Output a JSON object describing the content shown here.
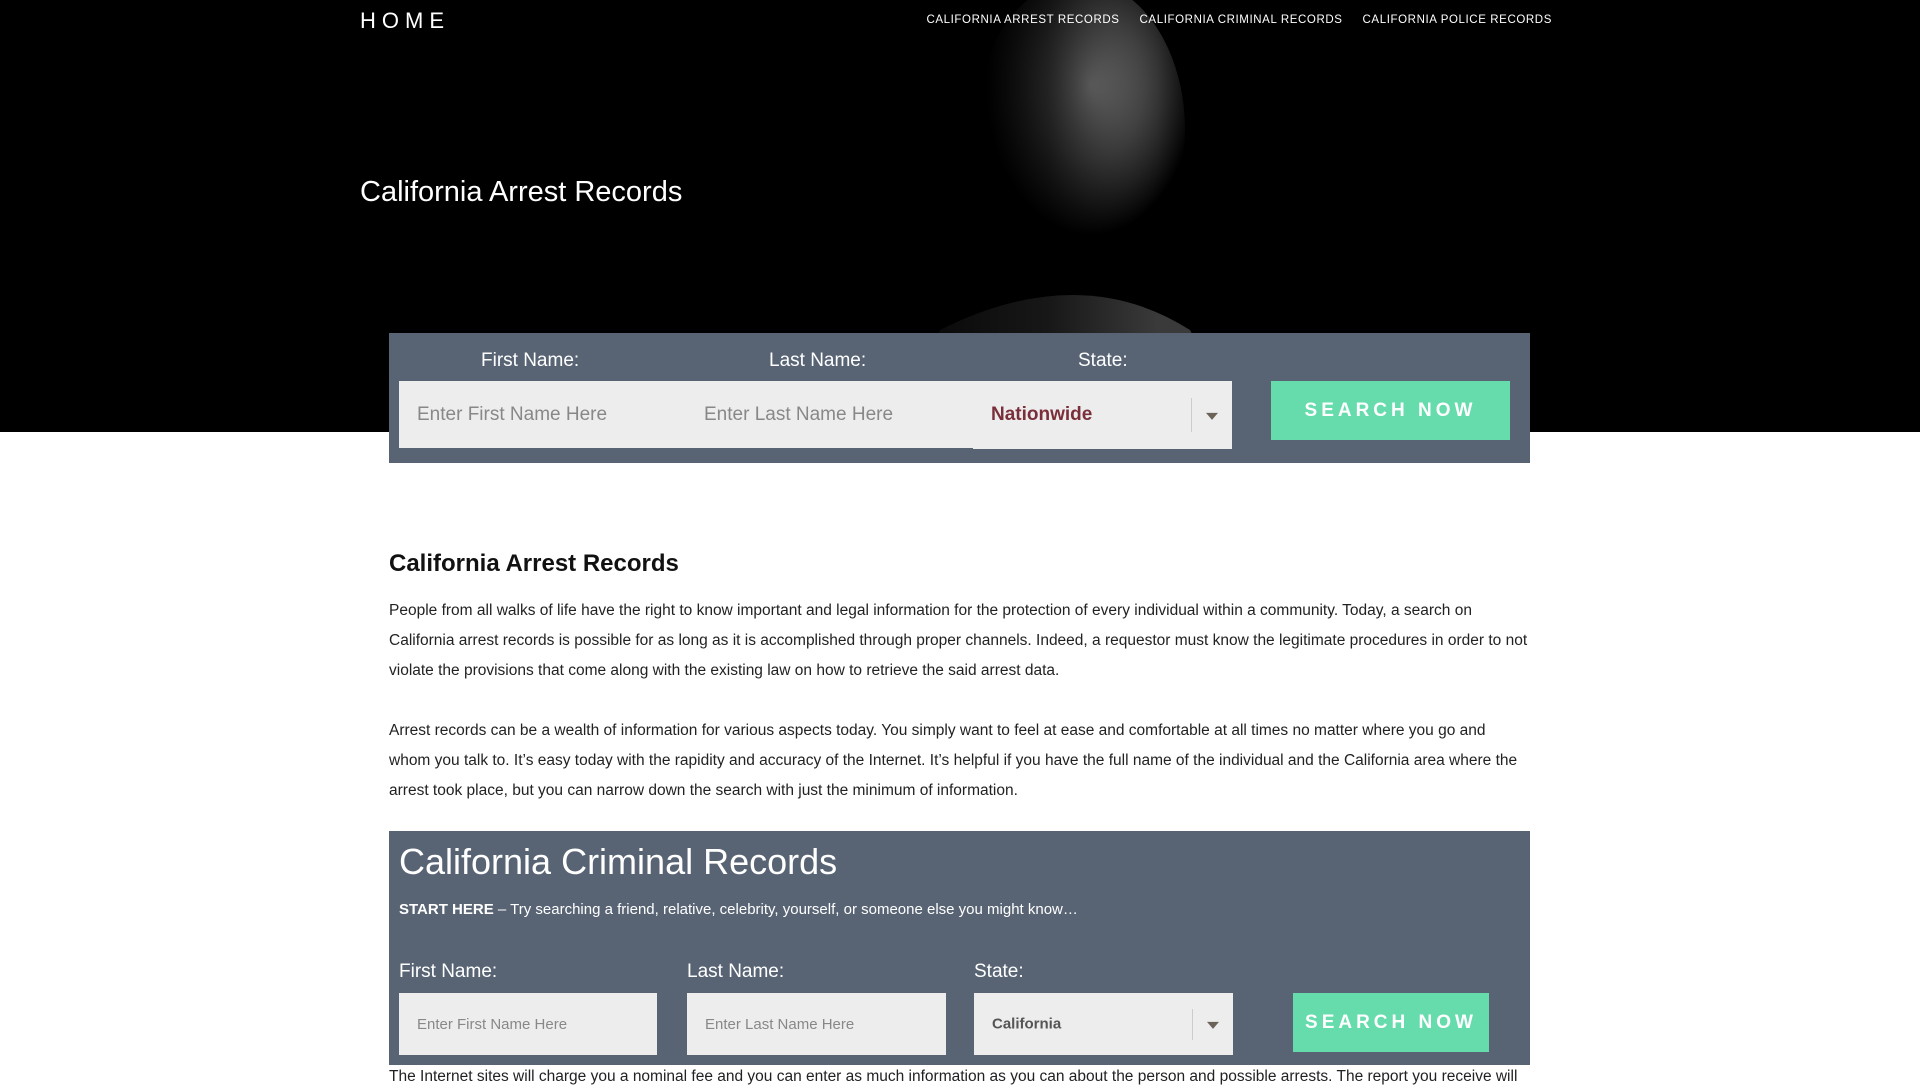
{
  "header": {
    "home_label": "HOME",
    "nav": [
      {
        "label": "CALIFORNIA ARREST RECORDS"
      },
      {
        "label": "CALIFORNIA CRIMINAL RECORDS"
      },
      {
        "label": "CALIFORNIA POLICE RECORDS"
      }
    ]
  },
  "hero": {
    "title": "California Arrest Records"
  },
  "search_top": {
    "first_name_label": "First Name:",
    "first_name_placeholder": "Enter First Name Here",
    "last_name_label": "Last Name:",
    "last_name_placeholder": "Enter Last Name Here",
    "state_label": "State:",
    "state_value": "Nationwide",
    "state_value_color": "#7a2f3a",
    "button_label": "SEARCH NOW"
  },
  "article": {
    "heading": "California Arrest Records",
    "paragraphs": [
      "People from all walks of life have the right to know important and legal information for the protection of every individual within a community. Today, a search on California arrest records is possible for as long as it is accomplished through proper channels. Indeed, a requestor must know the legitimate procedures in order to not violate the provisions that come along with the existing law on how to retrieve the said arrest data.",
      "Arrest records can be a wealth of information for various aspects today. You simply want to feel at ease and comfortable at all times no matter where you go and whom you talk to. It’s easy today with the rapidity and accuracy of the Internet. It’s helpful if you have the full name of the individual and the California area where the arrest took place, but you can narrow down the search with just the minimum of information."
    ]
  },
  "criminal_box": {
    "title": "California Criminal Records",
    "start_bold": "START HERE",
    "start_text": " – Try searching a friend, relative, celebrity, yourself, or someone else you might know…",
    "first_name_label": "First Name:",
    "first_name_placeholder": "Enter First Name Here",
    "last_name_label": "Last Name:",
    "last_name_placeholder": "Enter Last Name Here",
    "state_label": "State:",
    "state_value": "California",
    "button_label": "SEARCH NOW"
  },
  "bottom_text": "The Internet sites will charge you a nominal fee and you can enter as much information as you can about the person and possible arrests. The report you receive will",
  "colors": {
    "panel": "#586474",
    "button": "#66dcad",
    "input_bg": "#ededed"
  }
}
